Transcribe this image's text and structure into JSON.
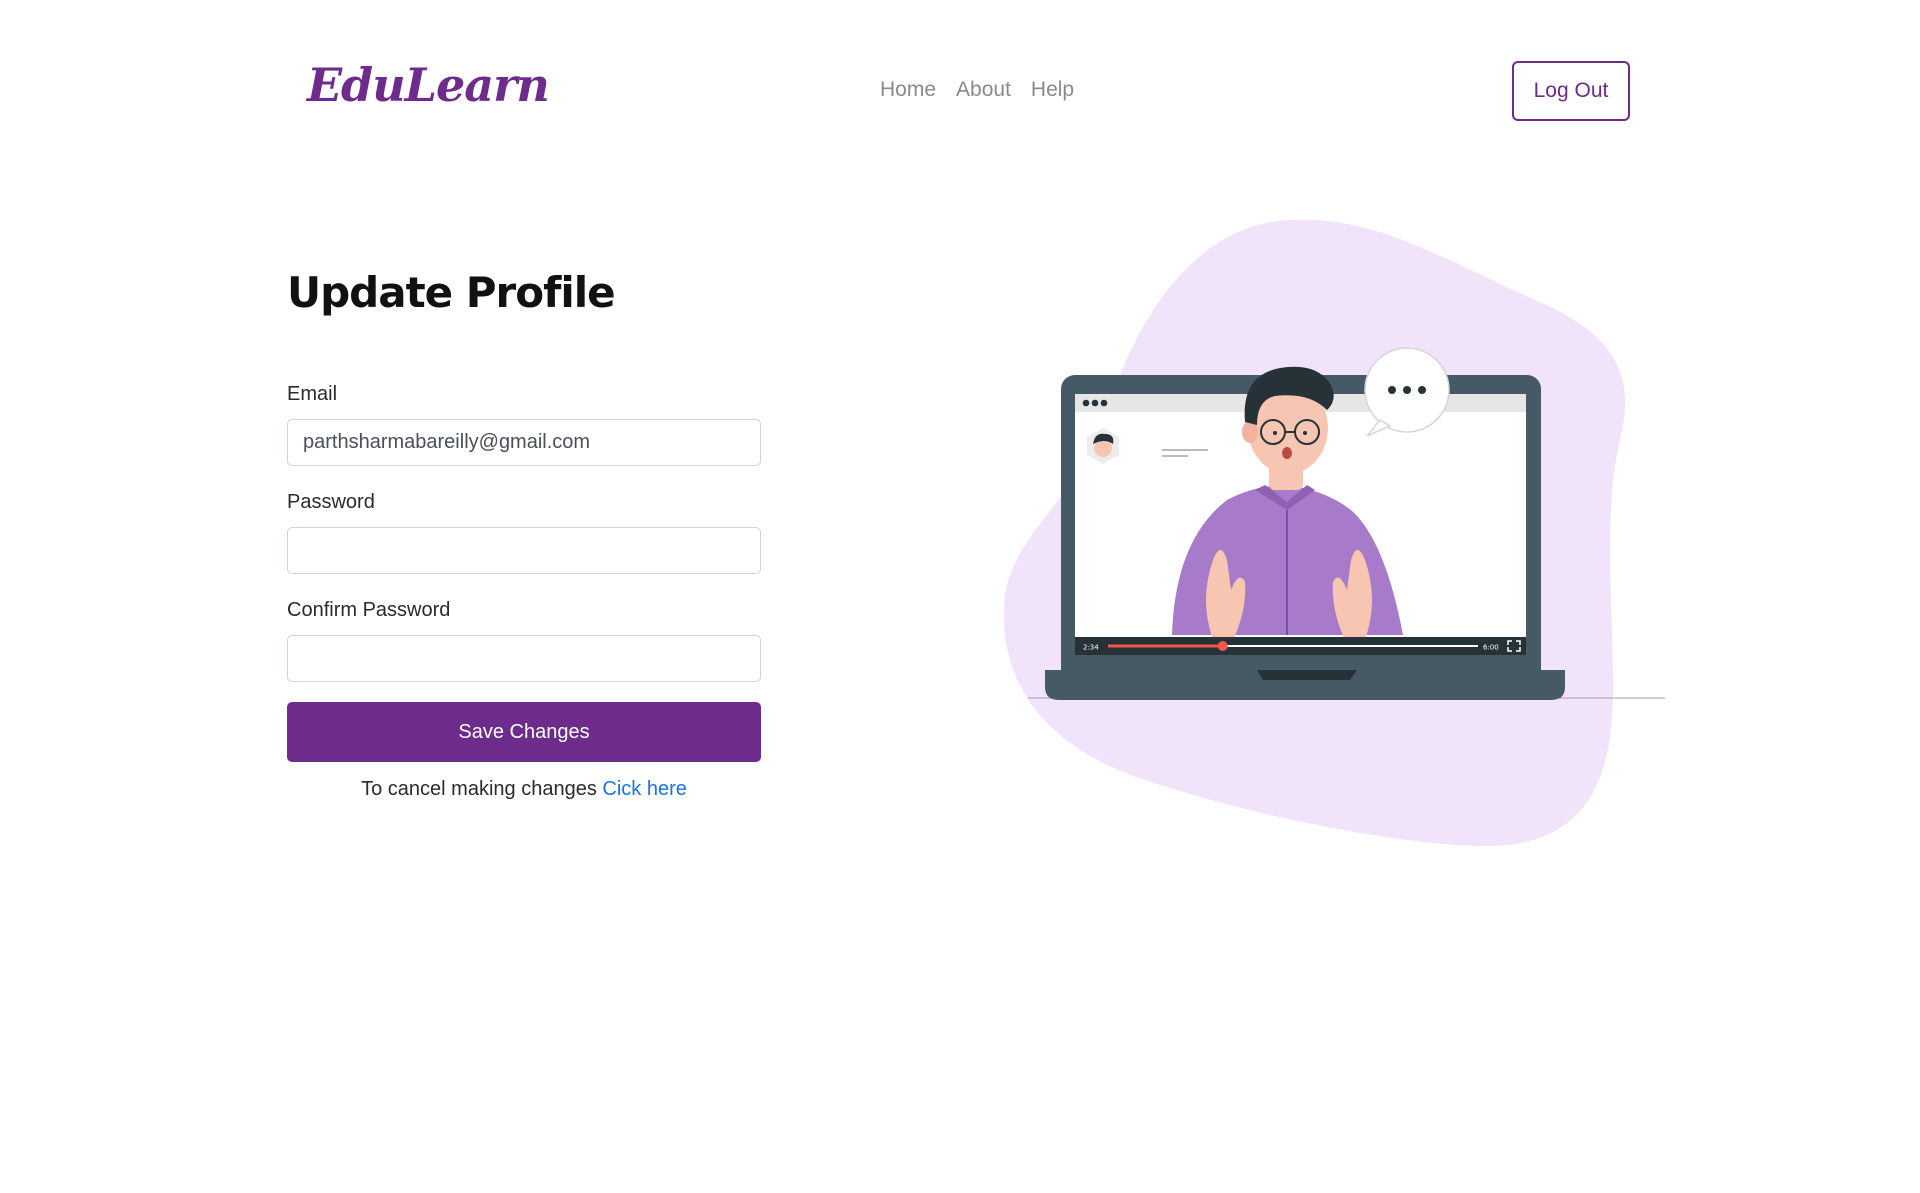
{
  "header": {
    "brand": "EduLearn",
    "nav": [
      {
        "label": "Home"
      },
      {
        "label": "About"
      },
      {
        "label": "Help"
      }
    ],
    "logout_label": "Log Out"
  },
  "form": {
    "title": "Update Profile",
    "email_label": "Email",
    "email_value": "parthsharmabareilly@gmail.com",
    "password_label": "Password",
    "password_value": "",
    "confirm_label": "Confirm Password",
    "confirm_value": "",
    "save_label": "Save Changes",
    "cancel_text": "To cancel making changes",
    "cancel_link": "Cick here"
  },
  "illustration": {
    "video_elapsed": "2:34",
    "video_total": "6:00",
    "video_progress": 0.31
  },
  "colors": {
    "brand": "#6d2b8b",
    "blob": "#f1e3f9",
    "laptop": "#455a64",
    "shirt": "#a77bca",
    "progress": "#f15a4a",
    "link": "#1a73e8"
  }
}
